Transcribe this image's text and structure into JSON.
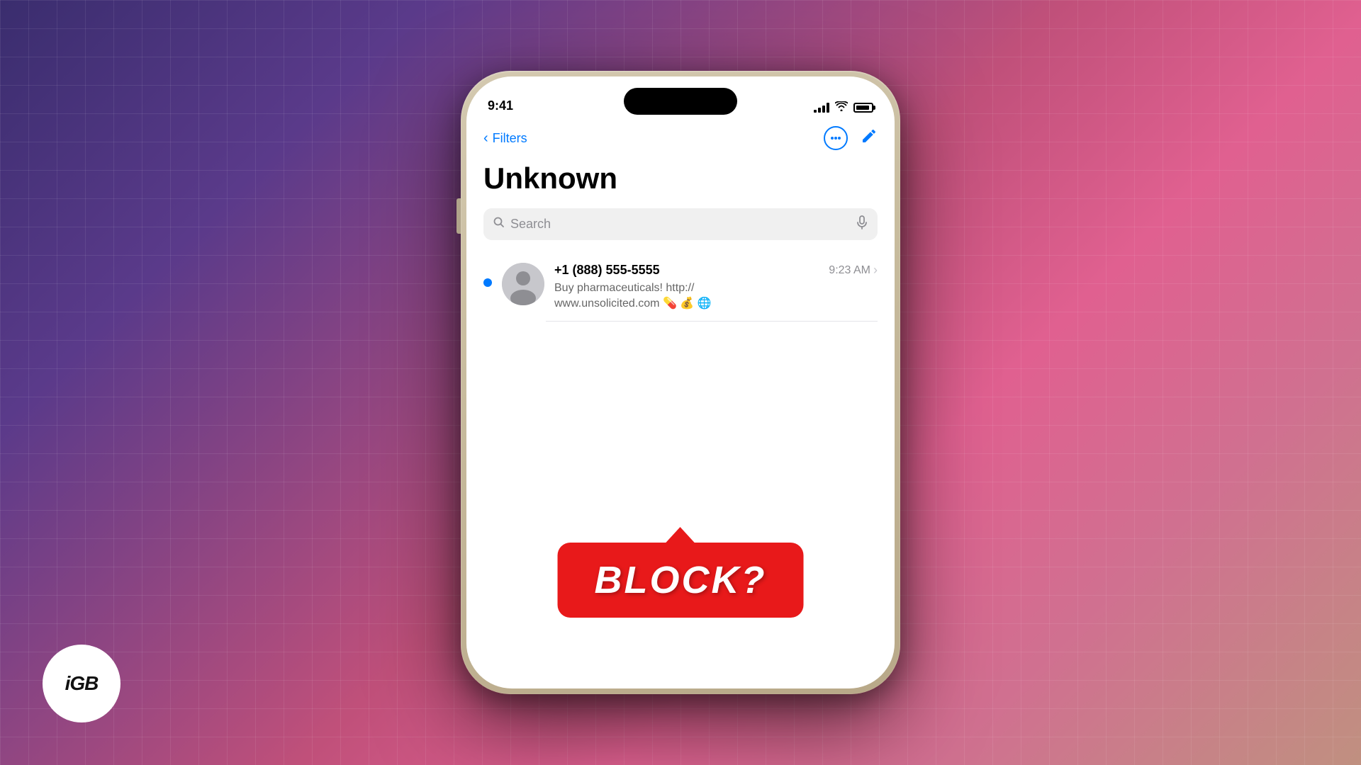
{
  "background": {
    "gradient_description": "purple to pink gradient with grid overlay"
  },
  "logo": {
    "text": "iGB"
  },
  "phone": {
    "status_bar": {
      "time": "9:41",
      "signal_bars": 4,
      "wifi": true,
      "battery_level": 90
    },
    "nav": {
      "back_label": "Filters",
      "more_icon": "ellipsis-circle-icon",
      "compose_icon": "compose-icon"
    },
    "title": "Unknown",
    "search": {
      "placeholder": "Search",
      "search_icon": "magnifying-glass-icon",
      "mic_icon": "microphone-icon"
    },
    "messages": [
      {
        "sender": "+1 (888) 555-5555",
        "time": "9:23 AM",
        "preview": "Buy pharmaceuticals! http://www.unsolicited.com 💊 💰 🌐",
        "unread": true
      }
    ],
    "block_badge": {
      "text": "BLOCK?"
    }
  }
}
